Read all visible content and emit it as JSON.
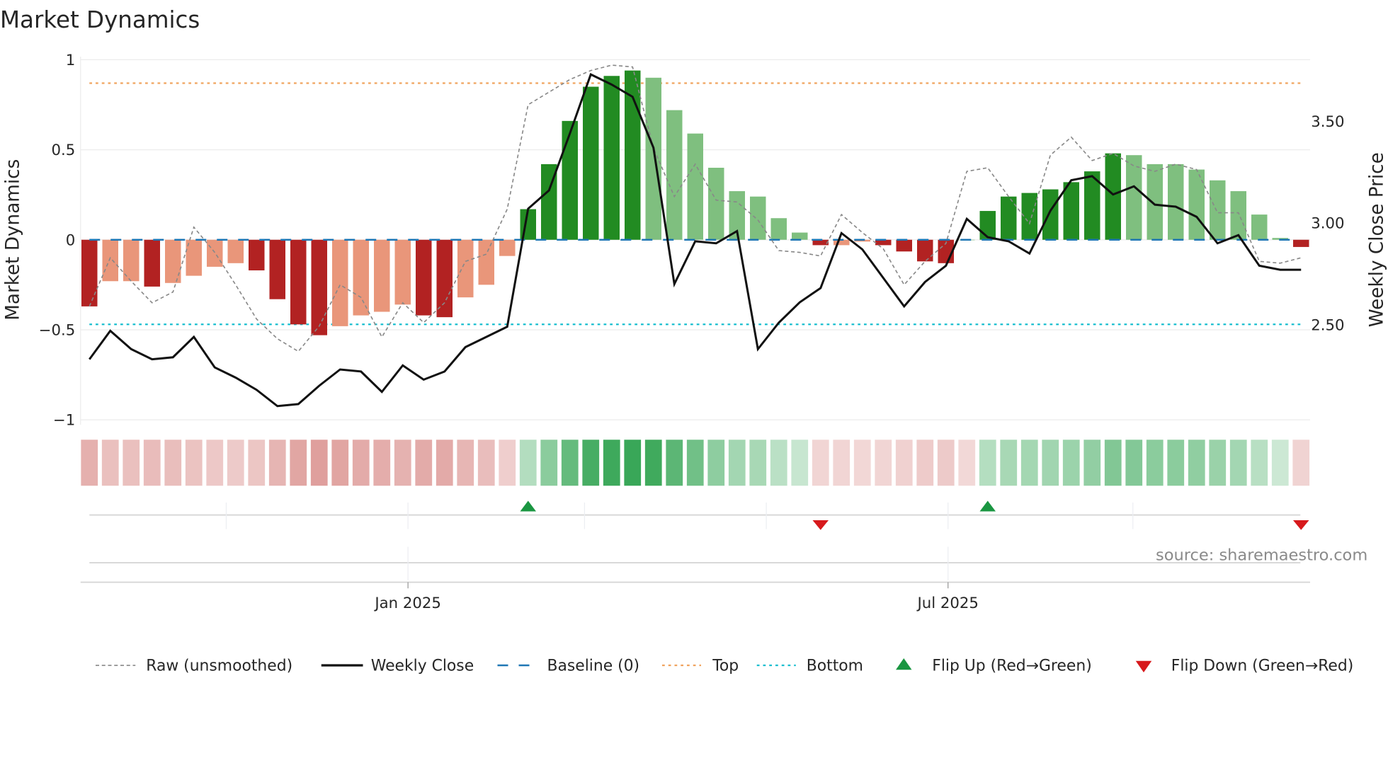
{
  "chart_data": {
    "type": "bar",
    "title": "Market Dynamics",
    "ylabel": "Market Dynamics",
    "ylabel_right": "Weekly Close Price",
    "ylim": [
      -1,
      1
    ],
    "ylim_right_ticks": [
      "3.50",
      "3.00",
      "2.50"
    ],
    "yticks_left": [
      "1",
      "0.5",
      "0",
      "−0.5",
      "−1"
    ],
    "yticks_left_values": [
      1,
      0.5,
      0,
      -0.5,
      -1
    ],
    "yticks_right_values": [
      3.5,
      3.0,
      2.5
    ],
    "xtick_labels": [
      "Jan 2025",
      "Jul 2025"
    ],
    "xtick_bar_index": [
      15.25,
      41.1
    ],
    "month_grid_bar_index": [
      6.55,
      15.25,
      23.7,
      32.4,
      41.1,
      49.95
    ],
    "top_level": 0.87,
    "bottom_level": -0.47,
    "baseline": 0,
    "bars": [
      -0.37,
      -0.23,
      -0.23,
      -0.26,
      -0.24,
      -0.2,
      -0.15,
      -0.13,
      -0.17,
      -0.33,
      -0.47,
      -0.53,
      -0.48,
      -0.42,
      -0.4,
      -0.36,
      -0.42,
      -0.43,
      -0.32,
      -0.25,
      -0.09,
      0.17,
      0.42,
      0.66,
      0.85,
      0.91,
      0.94,
      0.9,
      0.72,
      0.59,
      0.4,
      0.27,
      0.24,
      0.12,
      0.04,
      -0.03,
      -0.03,
      -0.01,
      -0.03,
      -0.065,
      -0.12,
      -0.13,
      0.0,
      0.16,
      0.24,
      0.26,
      0.28,
      0.32,
      0.38,
      0.48,
      0.47,
      0.42,
      0.42,
      0.39,
      0.33,
      0.27,
      0.14,
      0.01,
      -0.04
    ],
    "bar_strong": [
      1,
      0,
      0,
      1,
      0,
      0,
      0,
      0,
      1,
      1,
      1,
      1,
      0,
      0,
      0,
      0,
      1,
      1,
      0,
      0,
      0,
      1,
      1,
      1,
      1,
      1,
      1,
      0,
      0,
      0,
      0,
      0,
      0,
      0,
      0,
      1,
      0,
      0,
      1,
      1,
      1,
      1,
      0,
      1,
      1,
      1,
      1,
      1,
      1,
      1,
      0,
      0,
      0,
      0,
      0,
      0,
      0,
      0,
      1
    ],
    "raw": [
      -0.37,
      -0.1,
      -0.23,
      -0.35,
      -0.29,
      0.07,
      -0.07,
      -0.25,
      -0.44,
      -0.55,
      -0.62,
      -0.48,
      -0.25,
      -0.32,
      -0.54,
      -0.35,
      -0.46,
      -0.35,
      -0.12,
      -0.08,
      0.17,
      0.75,
      0.82,
      0.89,
      0.94,
      0.97,
      0.96,
      0.51,
      0.24,
      0.42,
      0.22,
      0.21,
      0.11,
      -0.06,
      -0.07,
      -0.09,
      0.14,
      0.04,
      -0.05,
      -0.25,
      -0.12,
      -0.02,
      0.38,
      0.4,
      0.24,
      0.09,
      0.47,
      0.57,
      0.44,
      0.48,
      0.41,
      0.38,
      0.42,
      0.39,
      0.15,
      0.15,
      -0.12,
      -0.13,
      -0.1
    ],
    "weekly_close": [
      2.33,
      2.47,
      2.38,
      2.33,
      2.34,
      2.44,
      2.29,
      2.24,
      2.18,
      2.1,
      2.11,
      2.2,
      2.28,
      2.27,
      2.17,
      2.3,
      2.23,
      2.27,
      2.39,
      2.44,
      2.49,
      3.07,
      3.16,
      3.44,
      3.73,
      3.68,
      3.62,
      3.37,
      2.7,
      2.91,
      2.9,
      2.96,
      2.38,
      2.51,
      2.61,
      2.68,
      2.95,
      2.87,
      2.73,
      2.59,
      2.71,
      2.79,
      3.02,
      2.93,
      2.91,
      2.85,
      3.06,
      3.21,
      3.23,
      3.14,
      3.18,
      3.09,
      3.08,
      3.03,
      2.9,
      2.94,
      2.79,
      2.77,
      2.77
    ],
    "flip_up_index": [
      21,
      43
    ],
    "flip_down_index": [
      35,
      58
    ],
    "colors": {
      "strong_red": "#b22222",
      "weak_red": "#e9967a",
      "strong_green": "#228b22",
      "weak_green": "#7fbf7f",
      "raw": "#888888",
      "close": "#111111",
      "baseline": "#1f77b4",
      "top": "#f0a35e",
      "bottom": "#17becf",
      "flip_up": "#1a9641",
      "flip_down": "#d7191c"
    },
    "legend": [
      "Raw (unsmoothed)",
      "Weekly Close",
      "Baseline (0)",
      "Top",
      "Bottom",
      "Flip Up (Red→Green)",
      "Flip Down (Green→Red)"
    ],
    "legend_placement": "bottom",
    "source": "source: sharemaestro.com"
  }
}
